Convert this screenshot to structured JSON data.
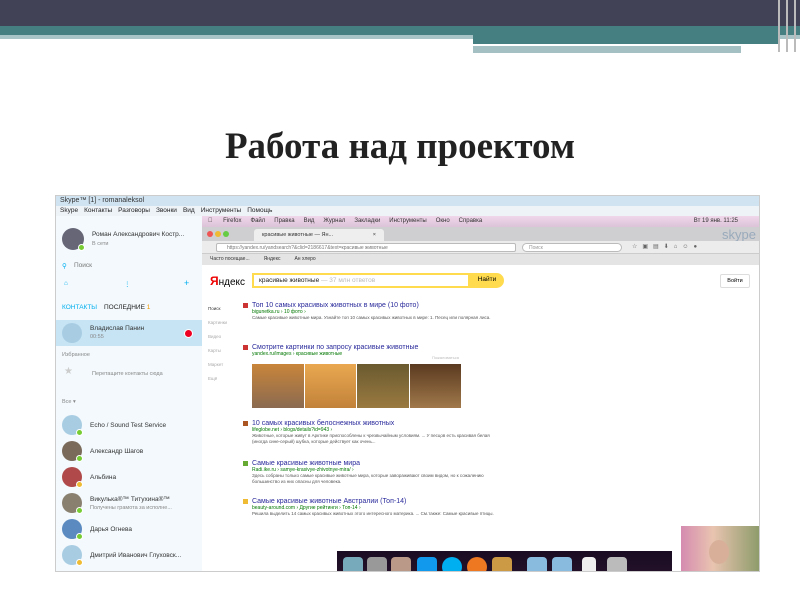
{
  "slide": {
    "title": "Работа над проектом"
  },
  "skype": {
    "window_title": "Skype™ [1] - romanaleksol",
    "menu": [
      "Skype",
      "Контакты",
      "Разговоры",
      "Звонки",
      "Вид",
      "Инструменты",
      "Помощь"
    ],
    "profile": {
      "name": "Роман Александрович Костр...",
      "status": "В сети"
    },
    "search_placeholder": "Поиск",
    "tab_contacts": "КОНТАКТЫ",
    "tab_recent": "ПОСЛЕДНИЕ",
    "recent_count": "1",
    "active_call": {
      "name": "Владислав Панин",
      "time": "00:55"
    },
    "favorites_label": "Избранное",
    "favorites_hint": "Перетащите контакты сюда",
    "all_label": "Все ▾",
    "contacts": [
      {
        "name": "Echo / Sound Test Service",
        "sub": "",
        "status": "online",
        "avatar": "#a8cde3"
      },
      {
        "name": "Александр Шагов",
        "sub": "",
        "status": "online",
        "avatar": "#7a6a5a"
      },
      {
        "name": "Альбина",
        "sub": "",
        "status": "away",
        "avatar": "#b04a4a"
      },
      {
        "name": "Викулька®™ Титухина®™",
        "sub": "Получены грамота за исполне...",
        "status": "online",
        "avatar": "#8a8070"
      },
      {
        "name": "Дарья Огнева",
        "sub": "",
        "status": "online",
        "avatar": "#5a8ac0"
      },
      {
        "name": "Дмитрий Иванович Глуховск...",
        "sub": "",
        "status": "away",
        "avatar": "#a8cde3"
      }
    ]
  },
  "browser": {
    "mac_menu": [
      "Firefox",
      "Файл",
      "Правка",
      "Вид",
      "Журнал",
      "Закладки",
      "Инструменты",
      "Окно",
      "Справка"
    ],
    "clock": "Вт 19 янв. 11:25",
    "tab_title": "красивые животные — Ян...",
    "url": "https://yandex.ru/yandsearch?&clid=2186617&text=красивые животные",
    "search_placeholder": "Поиск",
    "bookmarks": [
      "Часто посещае...",
      "Яндекс",
      "Ан хлеро"
    ],
    "yandex": {
      "logo_y": "Я",
      "logo_rest": "ндекс",
      "query": "красивые животные",
      "query_hint": "— 37 млн ответов",
      "button": "Найти",
      "login": "Войти",
      "side": [
        "Поиск",
        "Картинки",
        "Видео",
        "Карты",
        "Маркет",
        "Ещё"
      ],
      "results": [
        {
          "title": "Топ 10 самых красивых животных в мире (10 фото)",
          "url": "bigunetka.ru › 10 фото ›",
          "snippet": "Самые красивые животные мира. Узнайте топ 10 самых красивых животных в мире: 1. Песец или полярная лиса."
        },
        {
          "title": "Смотрите картинки по запросу красивые животные",
          "url": "yandex.ru/images › красивые животные",
          "snippet": ""
        },
        {
          "title": "10 самых красивых белоснежных животных",
          "url": "lifeglobe.net › blogs/details?id=943 ›",
          "snippet": "Животные, которые живут в Арктике приспособлены к чрезвычайным условиям. ... У песцов есть красивая белая (иногда сине-серый) шубка, которые действует как очень..."
        },
        {
          "title": "Самые красивые животные мира",
          "url": "Radi.ike.ru › samye-krasivye-zhivotnye-mira/ ›",
          "snippet": "Здесь собраны только самые красивые животные мира, которые завораживают своим видом, но к сожалению большинство из них опасны для человека."
        },
        {
          "title": "Самые красивые животные Австралии (Топ-14)",
          "url": "beauty-around.com › Другие рейтинги › Топ-14 ›",
          "snippet": "Решила выделить 14 самых красивых животных этого интересного материка. ... См.также: Самые красивые птицы."
        }
      ],
      "images_feedback": "Пожаловаться"
    }
  },
  "colors": {
    "accent_skype": "#00aff0",
    "yandex_yellow": "#ffdb4d",
    "slide_dark": "#424257",
    "slide_teal": "#457f82"
  }
}
